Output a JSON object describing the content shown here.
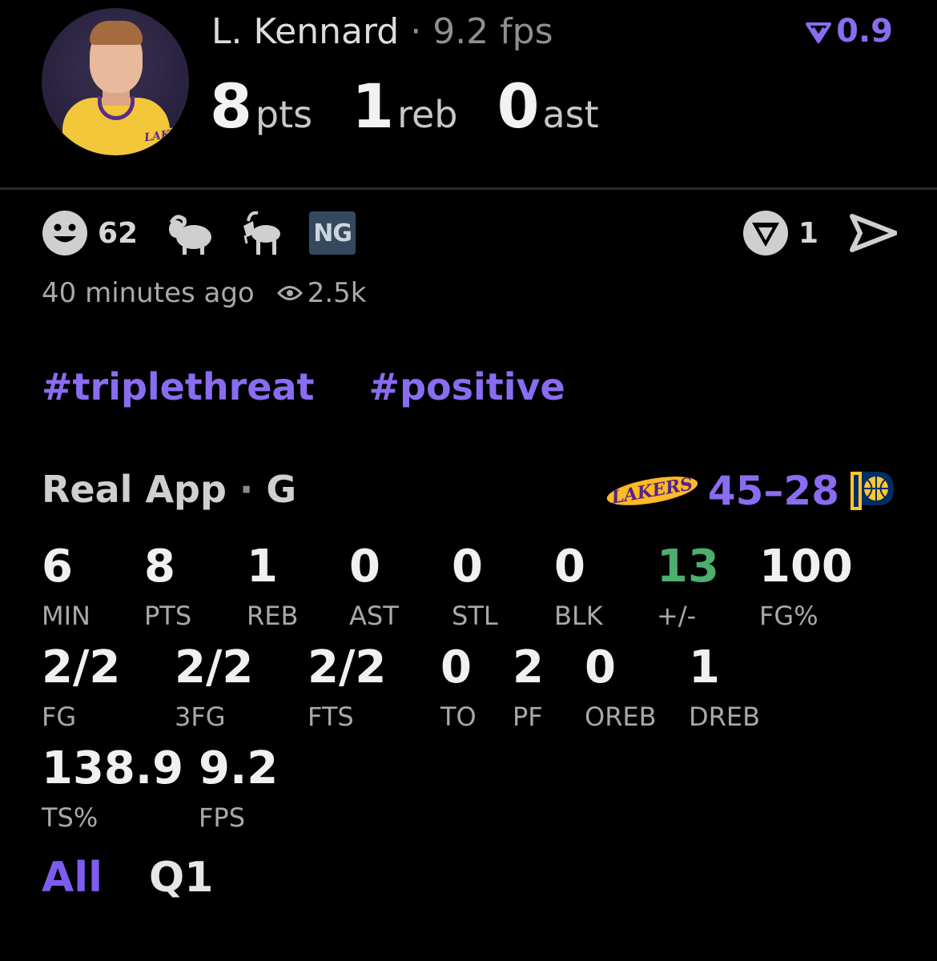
{
  "player": {
    "name": "L. Kennard",
    "separator": "·",
    "fps_label": "9.2 fps",
    "rating": "0.9",
    "headline": [
      {
        "value": "8",
        "unit": "pts"
      },
      {
        "value": "1",
        "unit": "reb"
      },
      {
        "value": "0",
        "unit": "ast"
      }
    ]
  },
  "reactions": {
    "smiley_count": "62",
    "badge": "NG",
    "vote_count": "1"
  },
  "meta": {
    "time_ago": "40 minutes ago",
    "views": "2.5k"
  },
  "tags": [
    "#triplethreat",
    "#positive"
  ],
  "game": {
    "source": "Real App",
    "dot": "·",
    "position": "G",
    "score_home": "45",
    "score_dash": "–",
    "score_away": "28",
    "home_logo_text": "LAKERS"
  },
  "stats_row1": [
    {
      "value": "6",
      "label": "MIN"
    },
    {
      "value": "8",
      "label": "PTS"
    },
    {
      "value": "1",
      "label": "REB"
    },
    {
      "value": "0",
      "label": "AST"
    },
    {
      "value": "0",
      "label": "STL"
    },
    {
      "value": "0",
      "label": "BLK"
    },
    {
      "value": "13",
      "label": "+/-",
      "color": "#4caf6e"
    },
    {
      "value": "100",
      "label": "FG%"
    }
  ],
  "stats_row2": [
    {
      "value": "2/2",
      "label": "FG"
    },
    {
      "value": "2/2",
      "label": "3FG"
    },
    {
      "value": "2/2",
      "label": "FTS"
    },
    {
      "value": "0",
      "label": "TO"
    },
    {
      "value": "2",
      "label": "PF"
    },
    {
      "value": "0",
      "label": "OREB"
    },
    {
      "value": "1",
      "label": "DREB"
    }
  ],
  "stats_row3": [
    {
      "value": "138.9",
      "label": "TS%"
    },
    {
      "value": "9.2",
      "label": "FPS"
    }
  ],
  "tabs": {
    "active": "All",
    "inactive": "Q1"
  },
  "colors": {
    "accent": "#8a6cf0",
    "positive": "#4caf6e",
    "background": "#000000"
  }
}
